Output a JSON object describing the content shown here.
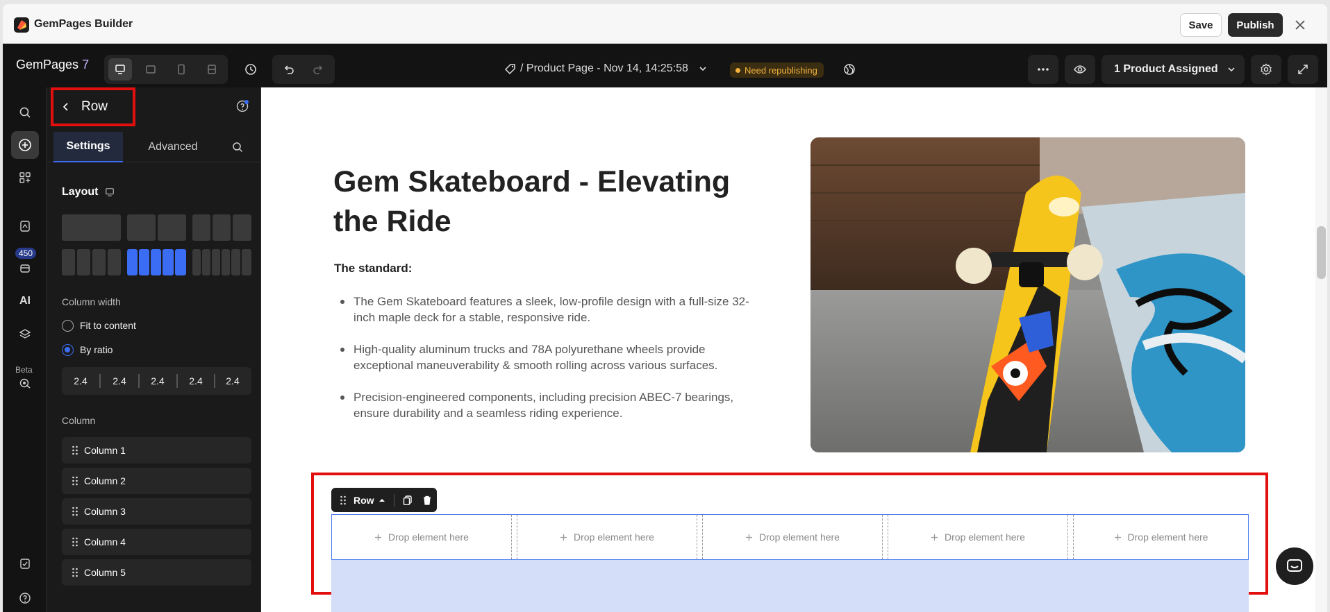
{
  "app": {
    "title": "GemPages Builder"
  },
  "titlebar": {
    "save_label": "Save",
    "publish_label": "Publish"
  },
  "toolbar": {
    "brand": "GemPages",
    "version": "7",
    "page_title": "/ Product Page - Nov 14, 14:25:58",
    "status_badge": "Need republishing",
    "assigned_label": "1 Product Assigned"
  },
  "rail": {
    "badge_count": "450",
    "ai_label": "AI",
    "beta_label": "Beta"
  },
  "panel": {
    "back_label": "Row",
    "tabs": [
      {
        "label": "Settings"
      },
      {
        "label": "Advanced"
      }
    ],
    "layout_title": "Layout",
    "column_width_label": "Column width",
    "options": [
      {
        "label": "Fit to content"
      },
      {
        "label": "By ratio"
      }
    ],
    "ratios": [
      "2.4",
      "2.4",
      "2.4",
      "2.4",
      "2.4"
    ],
    "column_title": "Column",
    "columns": [
      "Column 1",
      "Column 2",
      "Column 3",
      "Column 4",
      "Column 5"
    ]
  },
  "canvas": {
    "heading": "Gem Skateboard - Elevating the Ride",
    "subheading": "The standard:",
    "bullets": [
      "The Gem Skateboard features a sleek, low-profile design with a full-size 32-inch maple deck for a stable, responsive ride.",
      "High-quality aluminum trucks and 78A polyurethane wheels provide exceptional maneuverability & smooth rolling across various surfaces.",
      "Precision-engineered components, including precision ABEC-7 bearings, ensure durability and a seamless riding experience."
    ],
    "row_chip_label": "Row",
    "drop_label": "Drop element here",
    "drop_columns": [
      "Drop element here",
      "Drop element here",
      "Drop element here",
      "Drop element here",
      "Drop element here"
    ]
  },
  "colors": {
    "accent": "#3b6cf4",
    "highlight": "#e30f0f",
    "warning": "#f3b33b",
    "dark": "#131313"
  },
  "icons": [
    "gempages-logo",
    "close-icon",
    "desktop-icon",
    "tablet-icon",
    "mobile-icon",
    "responsive-icon",
    "history-icon",
    "undo-icon",
    "redo-icon",
    "tag-icon",
    "chevron-down-icon",
    "globe-icon",
    "more-icon",
    "eye-icon",
    "gear-icon",
    "expand-icon",
    "search-icon",
    "plus-circle-icon",
    "apps-icon",
    "pages-icon",
    "library-icon",
    "ai-icon",
    "layers-icon",
    "target-icon",
    "checklist-icon",
    "help-icon",
    "back-chevron-icon",
    "grip-icon",
    "copy-icon",
    "trash-icon",
    "plus-icon",
    "chat-icon"
  ]
}
